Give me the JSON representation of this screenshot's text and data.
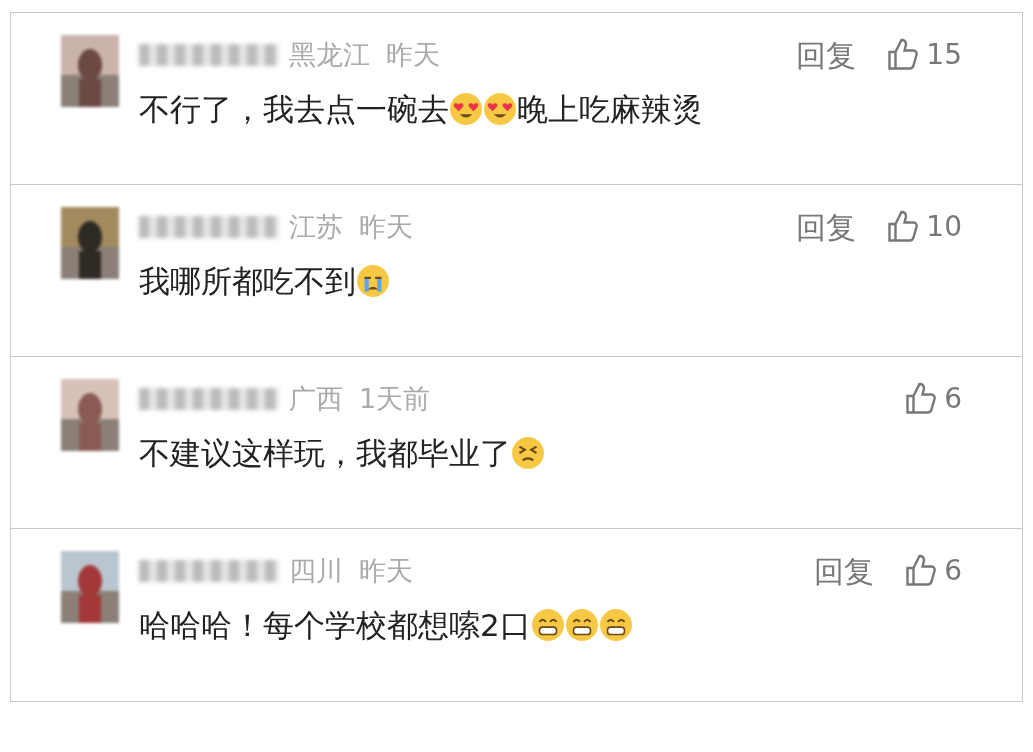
{
  "comments": [
    {
      "region": "黑龙江",
      "time": "昨天",
      "reply": "回复",
      "likes": "15",
      "segments": [
        {
          "kind": "text",
          "text": "不行了，我去点一碗去"
        },
        {
          "kind": "hearteyes"
        },
        {
          "kind": "hearteyes"
        },
        {
          "kind": "text",
          "text": "晚上吃麻辣烫"
        }
      ]
    },
    {
      "region": "江苏",
      "time": "昨天",
      "reply": "回复",
      "likes": "10",
      "segments": [
        {
          "kind": "text",
          "text": "我哪所都吃不到"
        },
        {
          "kind": "crying"
        }
      ]
    },
    {
      "region": "广西",
      "time": "1天前",
      "likes": "6",
      "segments": [
        {
          "kind": "text",
          "text": "不建议这样玩，我都毕业了"
        },
        {
          "kind": "squint"
        }
      ]
    },
    {
      "region": "四川",
      "time": "昨天",
      "reply": "回复",
      "likes": "6",
      "segments": [
        {
          "kind": "text",
          "text": "哈哈哈！每个学校都想嗦2口"
        },
        {
          "kind": "grin"
        },
        {
          "kind": "grin"
        },
        {
          "kind": "grin"
        }
      ]
    }
  ]
}
